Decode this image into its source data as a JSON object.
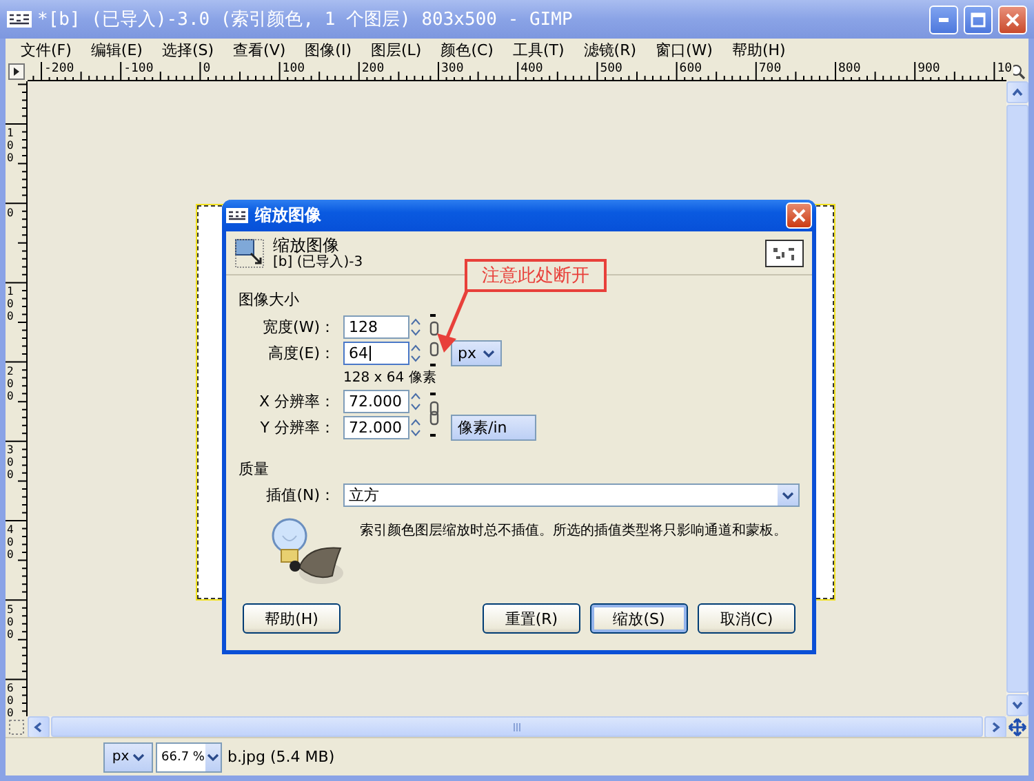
{
  "window": {
    "title": "*[b] (已导入)-3.0 (索引颜色, 1 个图层) 803x500 - GIMP"
  },
  "menu": [
    {
      "label": "文件(F)"
    },
    {
      "label": "编辑(E)"
    },
    {
      "label": "选择(S)"
    },
    {
      "label": "查看(V)"
    },
    {
      "label": "图像(I)"
    },
    {
      "label": "图层(L)"
    },
    {
      "label": "颜色(C)"
    },
    {
      "label": "工具(T)"
    },
    {
      "label": "滤镜(R)"
    },
    {
      "label": "窗口(W)"
    },
    {
      "label": "帮助(H)"
    }
  ],
  "rulers": {
    "horizontal": [
      "-200",
      "-100",
      "0",
      "100",
      "200",
      "300",
      "400",
      "500",
      "600",
      "700",
      "800",
      "900",
      "10"
    ],
    "vertical": [
      "100",
      "0",
      "100",
      "200",
      "300",
      "400",
      "500",
      "600"
    ]
  },
  "dialog": {
    "title": "缩放图像",
    "header_title": "缩放图像",
    "header_subtitle": "[b] (已导入)-3",
    "annotation": "注意此处断开",
    "image_size": {
      "heading": "图像大小",
      "width": {
        "label": "宽度(W)：",
        "value": "128",
        "focused": false
      },
      "height": {
        "label": "高度(E)：",
        "value": "64",
        "focused": true
      },
      "chain_linked": false,
      "unit": "px",
      "size_note": "128 x 64 像素"
    },
    "resolution": {
      "x": {
        "label": "X 分辨率：",
        "value": "72.000",
        "focused": false
      },
      "y": {
        "label": "Y 分辨率：",
        "value": "72.000",
        "focused": false
      },
      "chain_linked": true,
      "unit": "像素/in"
    },
    "quality": {
      "heading": "质量",
      "interpolation": {
        "label": "插值(N)：",
        "value": "立方"
      },
      "note": "索引颜色图层缩放时总不插值。所选的插值类型将只影响通道和蒙板。"
    },
    "buttons": [
      {
        "label": "帮助(H)",
        "default": false
      },
      {
        "label": "重置(R)",
        "default": false
      },
      {
        "label": "缩放(S)",
        "default": true
      },
      {
        "label": "取消(C)",
        "default": false
      }
    ]
  },
  "status_bar": {
    "unit": "px",
    "zoom": "66.7 %",
    "file": "b.jpg (5.4 MB)"
  }
}
